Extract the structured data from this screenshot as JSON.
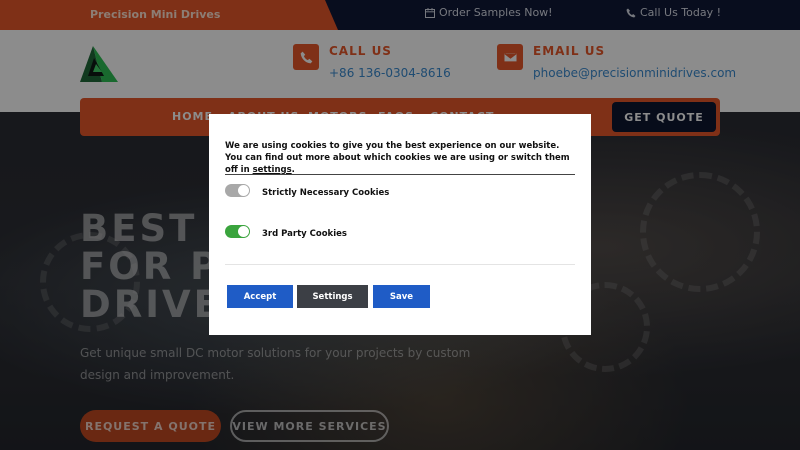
{
  "topbar": {
    "brand": "Precision Mini Drives",
    "samples": "Order Samples Now!",
    "call_today": "Call Us Today !"
  },
  "contact": {
    "call_title": "CALL US",
    "call_value": "+86 136-0304-8616",
    "email_title": "EMAIL US",
    "email_value": "phoebe@precisionminidrives.com"
  },
  "nav": {
    "items": [
      "HOME",
      "ABOUT US",
      "MOTORS",
      "FAQS",
      "CONTACT"
    ],
    "quote": "GET QUOTE"
  },
  "hero": {
    "title_lines": [
      "BEST S",
      "FOR P",
      "DRIVE"
    ],
    "subtitle": "Get unique small DC motor solutions for your projects by custom design and improvement.",
    "request_btn": "REQUEST A QUOTE",
    "view_btn": "VIEW MORE SERVICES"
  },
  "cookie": {
    "line1": "We are using cookies to give you the best experience on our website.",
    "line2_prefix": "You can find out more about which cookies we are using or switch them off in ",
    "settings_link": "settings",
    "line2_suffix": ".",
    "strict_label": "Strictly Necessary Cookies",
    "third_label": "3rd Party Cookies",
    "accept": "Accept",
    "settings": "Settings",
    "save": "Save"
  },
  "colors": {
    "accent": "#e8582a",
    "navy": "#0e1730",
    "link": "#3a8ad0",
    "btn_blue": "#1f5cc6",
    "btn_dark": "#3c3f45"
  },
  "icons": {
    "samples": "calendar-icon",
    "call_today": "phone-icon",
    "call": "phone-icon",
    "email": "envelope-icon",
    "logo": "triangle-logo"
  }
}
